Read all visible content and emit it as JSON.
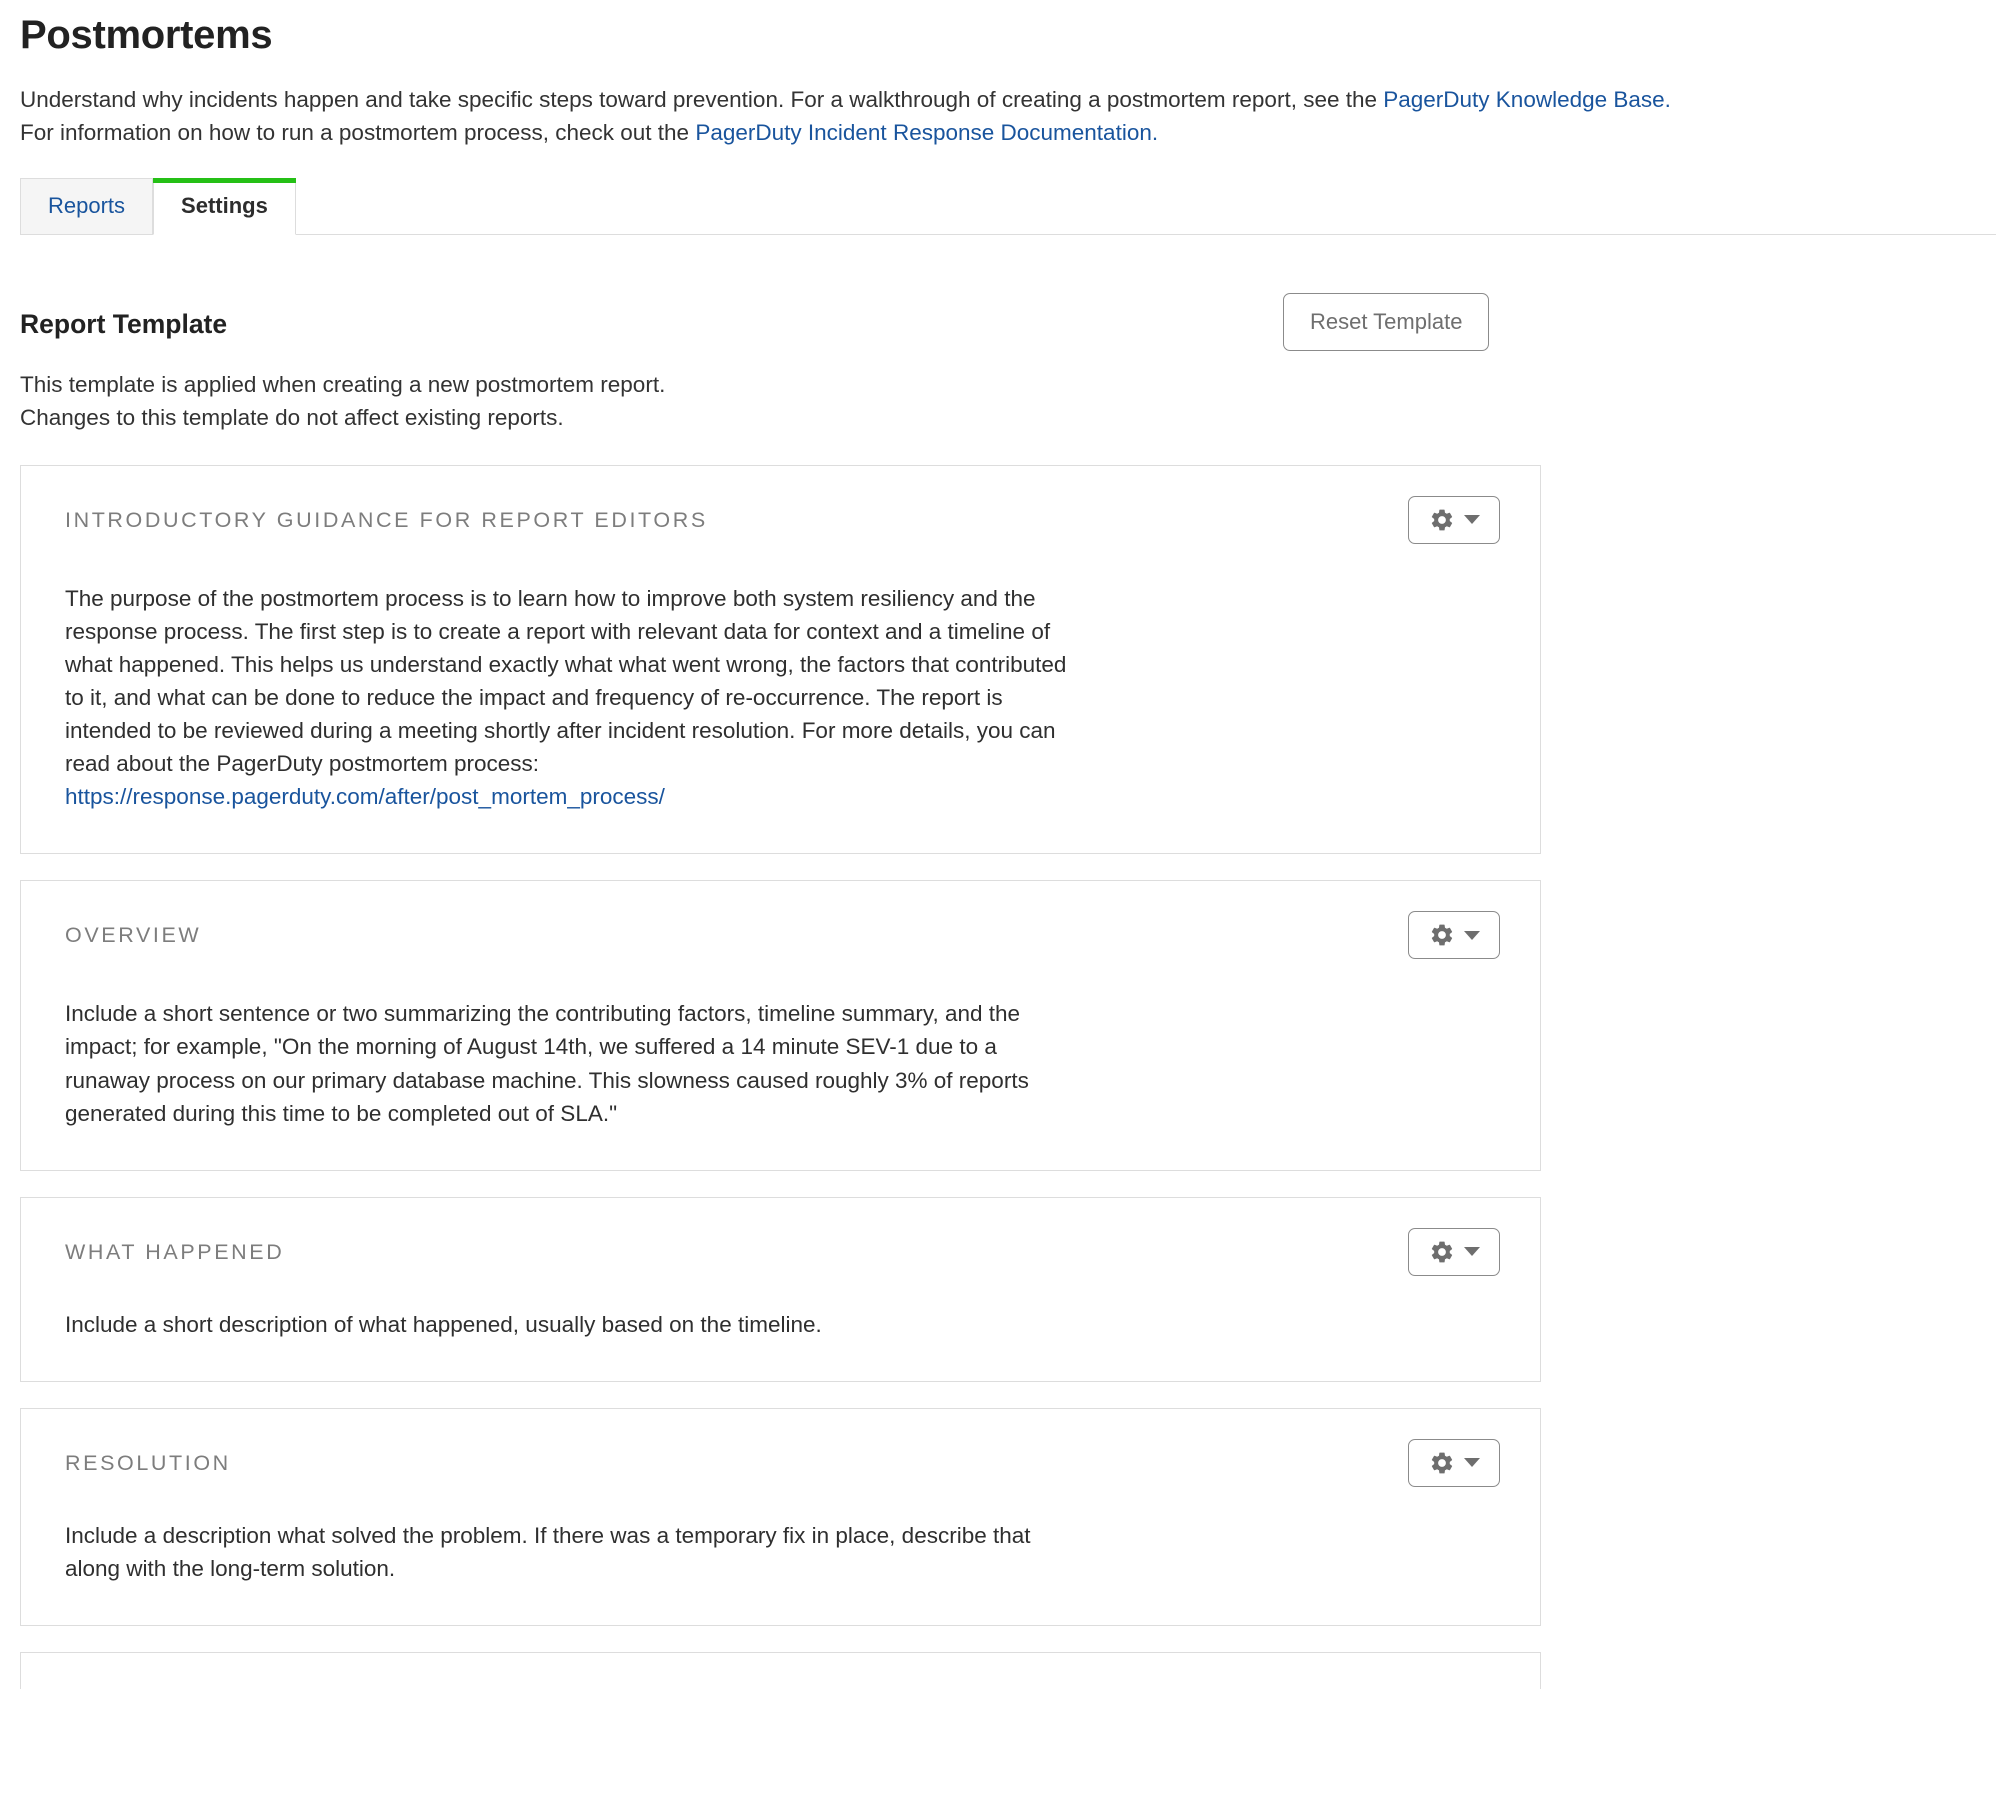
{
  "page": {
    "title": "Postmortems",
    "description_line1_before": "Understand why incidents happen and take specific steps toward prevention. For a walkthrough of creating a postmortem report, see the ",
    "description_link1": "PagerDuty Knowledge Base.",
    "description_line2_before": "For information on how to run a postmortem process, check out the ",
    "description_link2": "PagerDuty Incident Response Documentation."
  },
  "tabs": [
    {
      "label": "Reports",
      "active": false
    },
    {
      "label": "Settings",
      "active": true
    }
  ],
  "report_template": {
    "heading": "Report Template",
    "reset_button": "Reset Template",
    "desc_line1": "This template is applied when creating a new postmortem report.",
    "desc_line2": "Changes to this template do not affect existing reports.",
    "gear_icon": "gear-icon",
    "caret_icon": "chevron-down-icon"
  },
  "sections": [
    {
      "label": "INTRODUCTORY GUIDANCE FOR REPORT EDITORS",
      "body": "The purpose of the postmortem process is to learn how to improve both system resiliency and the response process. The first step is to create a report with relevant data for context and a timeline of what happened. This helps us understand exactly what what went wrong, the factors that contributed to it, and what can be done to reduce the impact and frequency of re-occurrence. The report is intended to be reviewed during a meeting shortly after incident resolution. For more details, you can read about the PagerDuty postmortem process:",
      "url": "https://response.pagerduty.com/after/post_mortem_process/"
    },
    {
      "label": "OVERVIEW",
      "body": "Include a short sentence or two summarizing the contributing factors, timeline summary, and the impact; for example, \"On the morning of August 14th, we suffered a 14 minute SEV-1 due to a runaway process on our primary database machine. This slowness caused roughly 3% of reports generated during this time to be completed out of SLA.\"",
      "url": ""
    },
    {
      "label": "WHAT HAPPENED",
      "body": "Include a short description of what happened, usually based on the timeline.",
      "url": ""
    },
    {
      "label": "RESOLUTION",
      "body": "Include a description what solved the problem. If there was a temporary fix in place, describe that along with the long-term solution.",
      "url": ""
    }
  ],
  "colors": {
    "active_tab_indicator": "#25c016",
    "link": "#19549d",
    "label_gray": "#7d7d7d",
    "border": "#dddddd"
  }
}
